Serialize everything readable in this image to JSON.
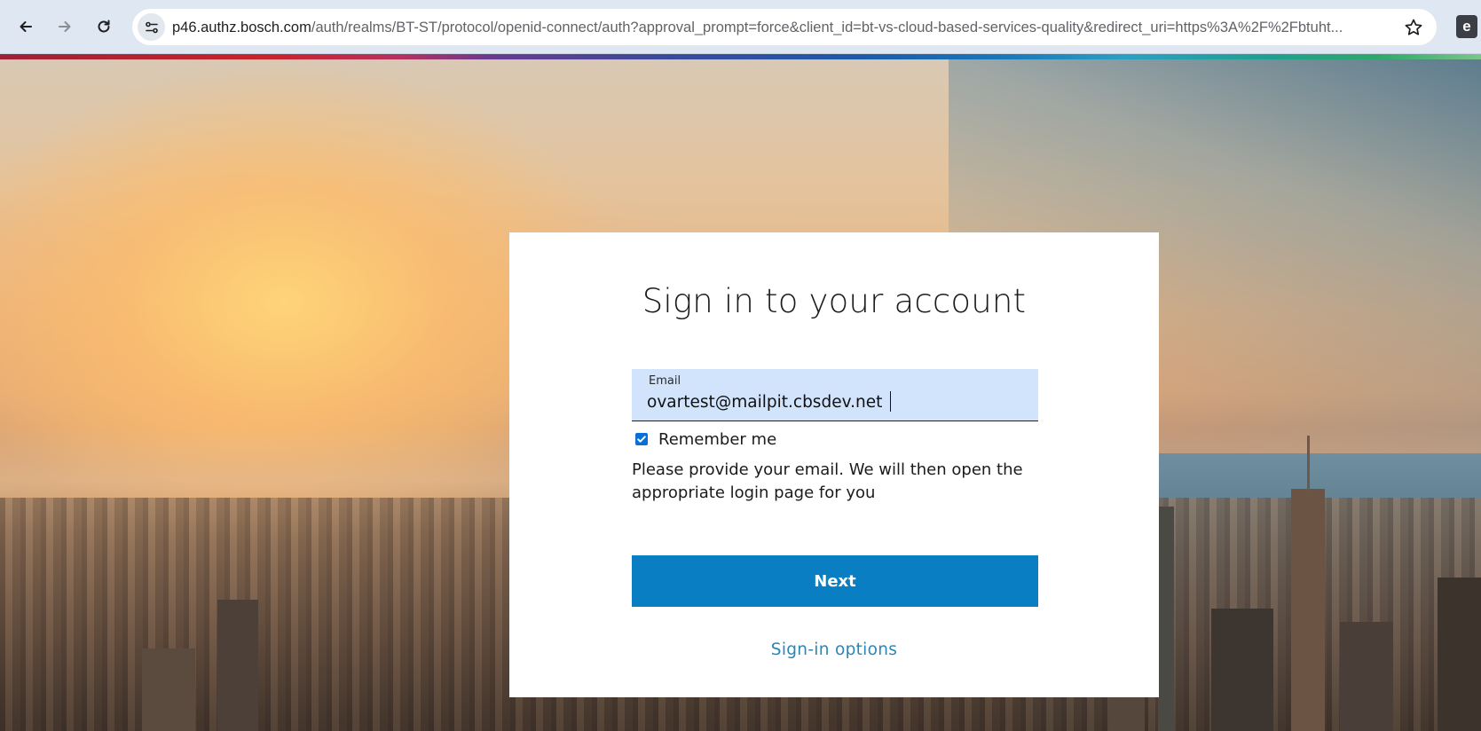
{
  "browser": {
    "url_host": "p46.authz.bosch.com",
    "url_path": "/auth/realms/BT-ST/protocol/openid-connect/auth?approval_prompt=force&client_id=bt-vs-cloud-based-services-quality&redirect_uri=https%3A%2F%2Fbtuht...",
    "icons": {
      "back": "back-arrow-icon",
      "forward": "forward-arrow-icon",
      "reload": "reload-icon",
      "site_info": "site-info-icon",
      "bookmark": "bookmark-star-icon",
      "extension": "extension-icon"
    },
    "extension_glyph": "e"
  },
  "page": {
    "brand_strip_colors": [
      "#9e2235",
      "#c9242b",
      "#6a3a8f",
      "#1d5aa8",
      "#2aa0c2",
      "#2ea86a"
    ]
  },
  "login": {
    "title": "Sign in to your account",
    "email": {
      "label": "Email",
      "value": "ovartest@mailpit.cbsdev.net"
    },
    "remember_me": {
      "label": "Remember me",
      "checked": true
    },
    "helper_text": "Please provide your email. We will then open the appropriate login page for you",
    "next_button": "Next",
    "signin_options": "Sign-in options"
  },
  "colors": {
    "primary_button": "#0a7ec2",
    "input_bg": "#d1e4fb",
    "link": "#2b86b6",
    "checkbox": "#0a6fd4"
  }
}
